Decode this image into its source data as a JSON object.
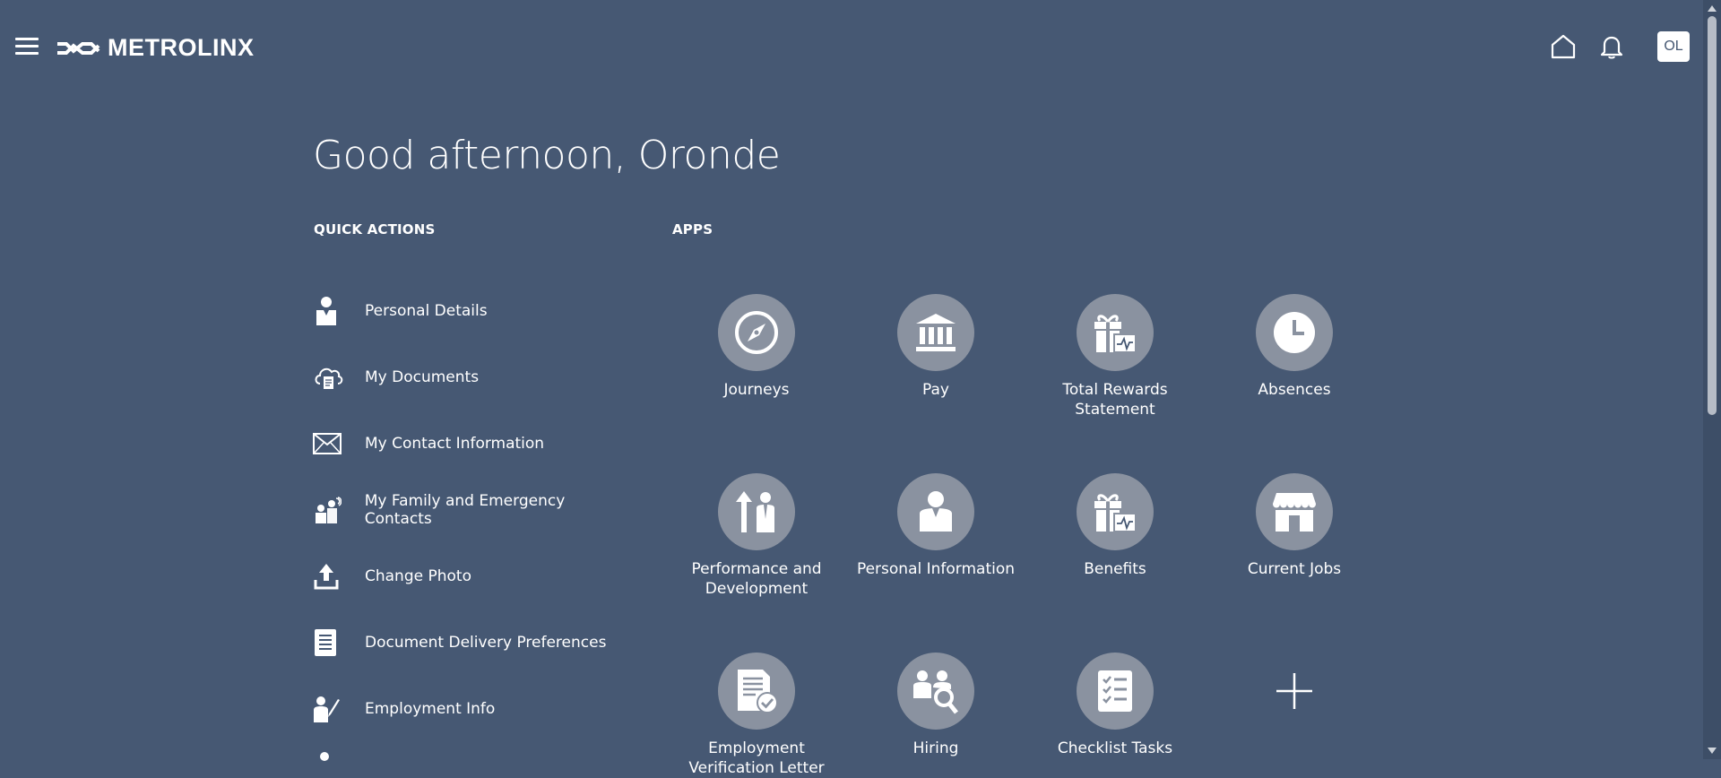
{
  "header": {
    "logo_text": "METROLINX",
    "avatar_initials": "OL"
  },
  "greeting": "Good afternoon, Oronde",
  "quick_actions": {
    "title": "QUICK ACTIONS",
    "items": [
      {
        "label": "Personal Details",
        "icon": "person-badge-icon"
      },
      {
        "label": "My Documents",
        "icon": "cloud-document-icon"
      },
      {
        "label": "My Contact Information",
        "icon": "envelope-icon"
      },
      {
        "label": "My Family and Emergency Contacts",
        "icon": "family-icon"
      },
      {
        "label": "Change Photo",
        "icon": "upload-icon"
      },
      {
        "label": "Document Delivery Preferences",
        "icon": "document-icon"
      },
      {
        "label": "Employment Info",
        "icon": "person-edit-icon"
      }
    ]
  },
  "apps": {
    "title": "APPS",
    "items": [
      {
        "label": "Journeys",
        "icon": "compass-icon"
      },
      {
        "label": "Pay",
        "icon": "bank-icon"
      },
      {
        "label": "Total Rewards Statement",
        "icon": "gift-chart-icon"
      },
      {
        "label": "Absences",
        "icon": "clock-icon"
      },
      {
        "label": "Performance and Development",
        "icon": "growth-person-icon"
      },
      {
        "label": "Personal Information",
        "icon": "person-icon"
      },
      {
        "label": "Benefits",
        "icon": "gift-chart-icon"
      },
      {
        "label": "Current Jobs",
        "icon": "storefront-icon"
      },
      {
        "label": "Employment Verification Letter",
        "icon": "document-check-icon"
      },
      {
        "label": "Hiring",
        "icon": "people-search-icon"
      },
      {
        "label": "Checklist Tasks",
        "icon": "checklist-icon"
      }
    ],
    "add_icon": "plus-icon"
  },
  "colors": {
    "background": "#465873",
    "app_circle": "#8a92a0",
    "text": "#ffffff"
  }
}
